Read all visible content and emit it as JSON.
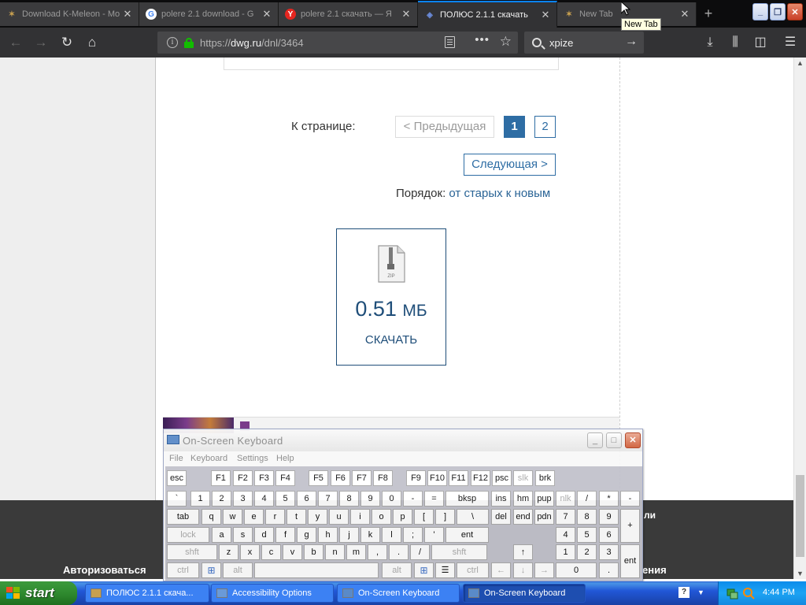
{
  "browser": {
    "tabs": [
      {
        "title": "Download K-Meleon - Mo",
        "icon": "k-meleon-icon"
      },
      {
        "title": "polere 2.1 download - G",
        "icon": "google-icon"
      },
      {
        "title": "polere 2.1 скачать — Я",
        "icon": "yandex-icon"
      },
      {
        "title": "ПОЛЮС 2.1.1 скачать",
        "icon": "dwg-icon",
        "active": true
      },
      {
        "title": "New Tab",
        "icon": "k-meleon-icon"
      }
    ],
    "tooltip": "New Tab",
    "url_prefix": "https://",
    "url_domain": "dwg.ru",
    "url_path": "/dnl/3464",
    "search_query": "xpize"
  },
  "pagination": {
    "label": "К странице:",
    "prev": "< Предыдущая",
    "current": "1",
    "page2": "2",
    "next": "Следующая >"
  },
  "order": {
    "label": "Порядок:",
    "value": "от старых к новым"
  },
  "file": {
    "icon_label": "ZIP",
    "size_value": "0.51",
    "size_unit": "МБ",
    "download_label": "СКАЧАТЬ"
  },
  "footer": {
    "login": "Авторизоваться",
    "fragment1": "ли",
    "fragment2": "ения"
  },
  "osk": {
    "title": "On-Screen Keyboard",
    "menu": [
      "File",
      "Keyboard",
      "Settings",
      "Help"
    ],
    "rows": {
      "fn": [
        "esc",
        "F1",
        "F2",
        "F3",
        "F4",
        "F5",
        "F6",
        "F7",
        "F8",
        "F9",
        "F10",
        "F11",
        "F12",
        "psc",
        "slk",
        "brk"
      ],
      "num": [
        "`",
        "1",
        "2",
        "3",
        "4",
        "5",
        "6",
        "7",
        "8",
        "9",
        "0",
        "-",
        "=",
        "bksp",
        "ins",
        "hm",
        "pup",
        "nlk",
        "/",
        "*",
        "-"
      ],
      "top": [
        "tab",
        "q",
        "w",
        "e",
        "r",
        "t",
        "y",
        "u",
        "i",
        "o",
        "p",
        "[",
        "]",
        "\\",
        "del",
        "end",
        "pdn",
        "7",
        "8",
        "9",
        "+"
      ],
      "home": [
        "lock",
        "a",
        "s",
        "d",
        "f",
        "g",
        "h",
        "j",
        "k",
        "l",
        ";",
        "'",
        "ent",
        "4",
        "5",
        "6"
      ],
      "shift": [
        "shft",
        "z",
        "x",
        "c",
        "v",
        "b",
        "n",
        "m",
        ",",
        ".",
        "/",
        "shft",
        "↑",
        "1",
        "2",
        "3",
        "ent"
      ],
      "bottom": [
        "ctrl",
        "⊞",
        "alt",
        "",
        "alt",
        "⊞",
        "☰",
        "ctrl",
        "←",
        "↓",
        "→",
        "0",
        "."
      ]
    }
  },
  "taskbar": {
    "start": "start",
    "tasks": [
      "ПОЛЮС 2.1.1 скача...",
      "Accessibility Options",
      "On-Screen Keyboard",
      "On-Screen Keyboard"
    ],
    "clock": "4:44 PM"
  }
}
